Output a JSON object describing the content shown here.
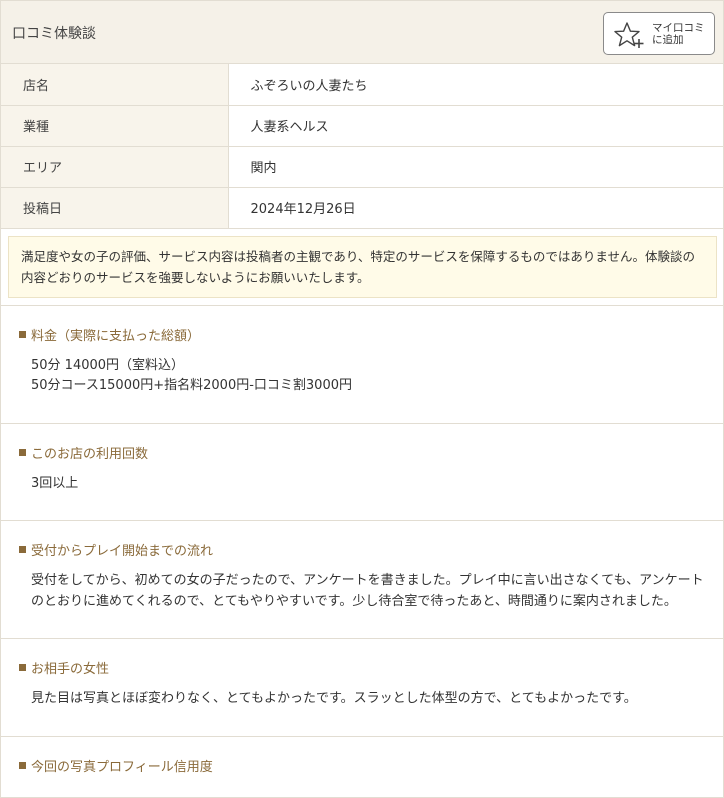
{
  "header": {
    "title": "口コミ体験談",
    "button_line1": "マイ口コミ",
    "button_line2": "に追加"
  },
  "info": [
    {
      "label": "店名",
      "value": "ふぞろいの人妻たち"
    },
    {
      "label": "業種",
      "value": "人妻系ヘルス"
    },
    {
      "label": "エリア",
      "value": "関内"
    },
    {
      "label": "投稿日",
      "value": "2024年12月26日"
    }
  ],
  "notice": "満足度や女の子の評価、サービス内容は投稿者の主観であり、特定のサービスを保障するものではありません。体験談の内容どおりのサービスを強要しないようにお願いいたします。",
  "sections": [
    {
      "title": "料金（実際に支払った総額）",
      "lines": [
        "50分 14000円（室料込）",
        "50分コース15000円+指名料2000円-口コミ割3000円"
      ]
    },
    {
      "title": "このお店の利用回数",
      "lines": [
        "3回以上"
      ]
    },
    {
      "title": "受付からプレイ開始までの流れ",
      "lines": [
        "受付をしてから、初めての女の子だったので、アンケートを書きました。プレイ中に言い出さなくても、アンケートのとおりに進めてくれるので、とてもやりやすいです。少し待合室で待ったあと、時間通りに案内されました。"
      ]
    },
    {
      "title": "お相手の女性",
      "lines": [
        "見た目は写真とほぼ変わりなく、とてもよかったです。スラッとした体型の方で、とてもよかったです。"
      ]
    },
    {
      "title": "今回の写真プロフィール信用度",
      "lines": []
    }
  ],
  "colors": {
    "accent": "#8a6a3a",
    "header_bg": "#f5f1e8",
    "label_bg": "#f8f4eb",
    "notice_bg": "#fffbe8"
  }
}
